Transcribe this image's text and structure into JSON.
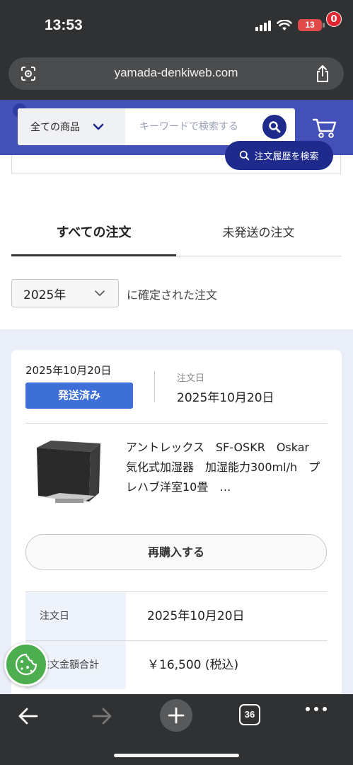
{
  "status_bar": {
    "time": "13:53",
    "battery": "13"
  },
  "browser": {
    "url": "yamada-denkiweb.com",
    "tab_count": "36"
  },
  "header": {
    "category": "全ての商品",
    "search_placeholder": "キーワードで検索する",
    "cart_count": "0",
    "accent_color": "#4350b8",
    "dark_color": "#1e2a8c"
  },
  "order_search": {
    "history_button": "注文履歴を検索"
  },
  "tabs": {
    "all": "すべての注文",
    "unshipped": "未発送の注文"
  },
  "filter": {
    "year": "2025年",
    "suffix": "に確定された注文"
  },
  "order": {
    "date": "2025年10月20日",
    "status": "発送済み",
    "order_date_label": "注文日",
    "order_date_value": "2025年10月20日",
    "product_name": "アントレックス　SF-OSKR　Oskar　気化式加湿器　加湿能力300ml/h　プレハブ洋室10畳　…",
    "rebuy_button": "再購入する",
    "details": [
      {
        "label": "注文日",
        "value": "2025年10月20日"
      },
      {
        "label": "注文金額合計",
        "value": "￥16,500 (税込)"
      }
    ]
  }
}
